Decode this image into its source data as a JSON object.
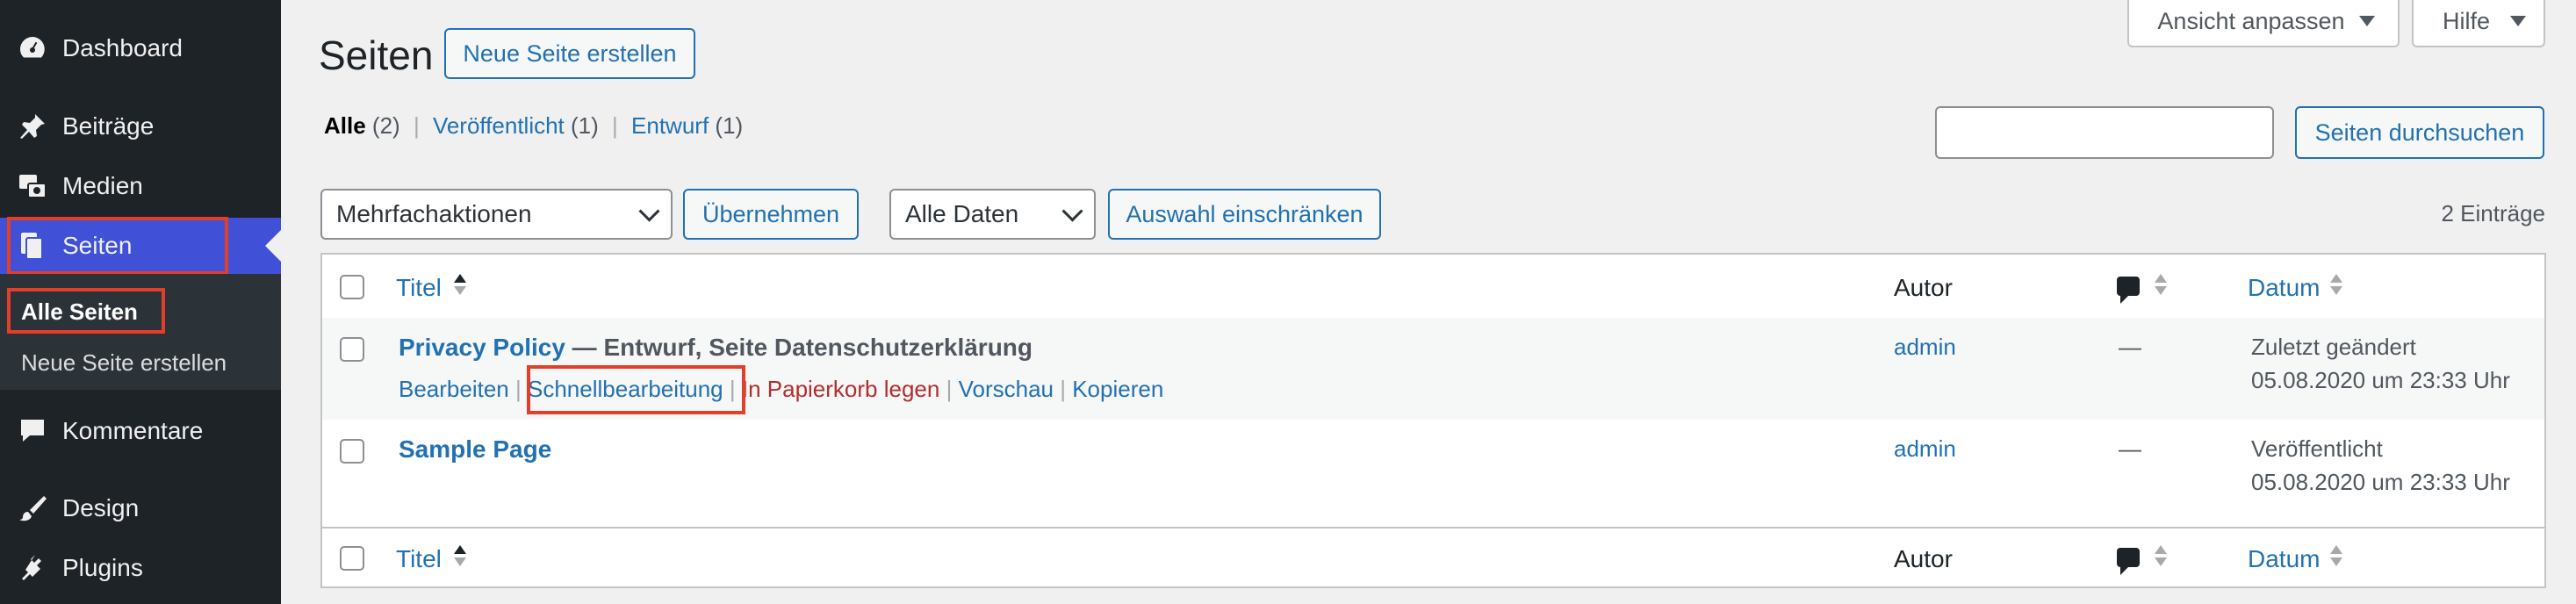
{
  "sidebar": {
    "items": [
      {
        "label": "Dashboard",
        "icon": "dashboard-icon"
      },
      {
        "label": "Beiträge",
        "icon": "pin-icon"
      },
      {
        "label": "Medien",
        "icon": "media-icon"
      },
      {
        "label": "Seiten",
        "icon": "pages-icon"
      },
      {
        "label": "Kommentare",
        "icon": "comment-icon"
      },
      {
        "label": "Design",
        "icon": "brush-icon"
      },
      {
        "label": "Plugins",
        "icon": "plugin-icon"
      }
    ],
    "submenu": [
      {
        "label": "Alle Seiten"
      },
      {
        "label": "Neue Seite erstellen"
      }
    ]
  },
  "header": {
    "title": "Seiten",
    "add_new": "Neue Seite erstellen",
    "screen_options": "Ansicht anpassen",
    "help": "Hilfe"
  },
  "filters": {
    "all": "Alle",
    "all_count": "(2)",
    "published": "Veröffentlicht",
    "published_count": "(1)",
    "draft": "Entwurf",
    "draft_count": "(1)",
    "sep": "|"
  },
  "search": {
    "button": "Seiten durchsuchen",
    "value": ""
  },
  "toolbar": {
    "bulk_select": "Mehrfachaktionen",
    "apply": "Übernehmen",
    "date_select": "Alle Daten",
    "filter": "Auswahl einschränken",
    "count": "2 Einträge"
  },
  "table": {
    "columns": {
      "title": "Titel",
      "author": "Autor",
      "date": "Datum"
    },
    "rows": [
      {
        "title": "Privacy Policy",
        "state": " — Entwurf, Seite Datenschutzerklärung",
        "author": "admin",
        "comments": "—",
        "date_status": "Zuletzt geändert",
        "date": "05.08.2020 um 23:33 Uhr",
        "actions": {
          "edit": "Bearbeiten",
          "quick": "Schnellbearbeitung",
          "trash": "In Papierkorb legen",
          "view": "Vorschau",
          "copy": "Kopieren"
        }
      },
      {
        "title": "Sample Page",
        "author": "admin",
        "comments": "—",
        "date_status": "Veröffentlicht",
        "date": "05.08.2020 um 23:33 Uhr"
      }
    ]
  },
  "colors": {
    "sidebar_bg": "#1d2327",
    "active": "#4051d8",
    "link": "#2271b1",
    "trash": "#b32d2e",
    "highlight": "#e23e2a"
  }
}
